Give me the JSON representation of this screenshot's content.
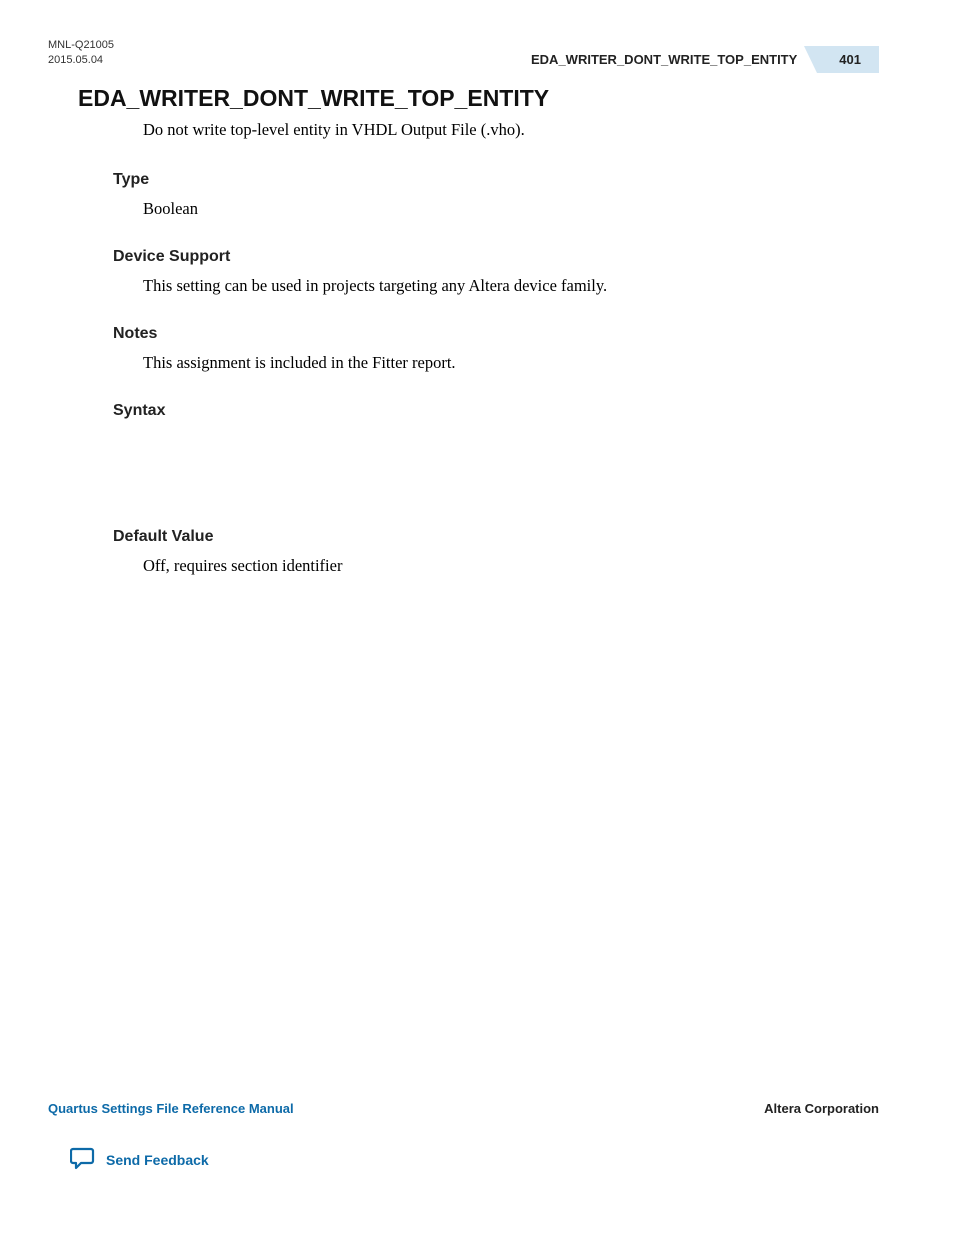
{
  "header": {
    "doc_id": "MNL-Q21005",
    "date": "2015.05.04",
    "running_title": "EDA_WRITER_DONT_WRITE_TOP_ENTITY",
    "page_number": "401"
  },
  "title": "EDA_WRITER_DONT_WRITE_TOP_ENTITY",
  "intro": "Do not write top-level entity in VHDL Output File (.vho).",
  "sections": {
    "type": {
      "heading": "Type",
      "body": "Boolean"
    },
    "device_support": {
      "heading": "Device Support",
      "body": "This setting can be used in projects targeting any Altera device family."
    },
    "notes": {
      "heading": "Notes",
      "body": "This assignment is included in the Fitter report."
    },
    "syntax": {
      "heading": "Syntax",
      "body": ""
    },
    "default_value": {
      "heading": "Default Value",
      "body": "Off, requires section identifier"
    }
  },
  "footer": {
    "manual": "Quartus Settings File Reference Manual",
    "company": "Altera Corporation",
    "feedback": "Send Feedback"
  }
}
